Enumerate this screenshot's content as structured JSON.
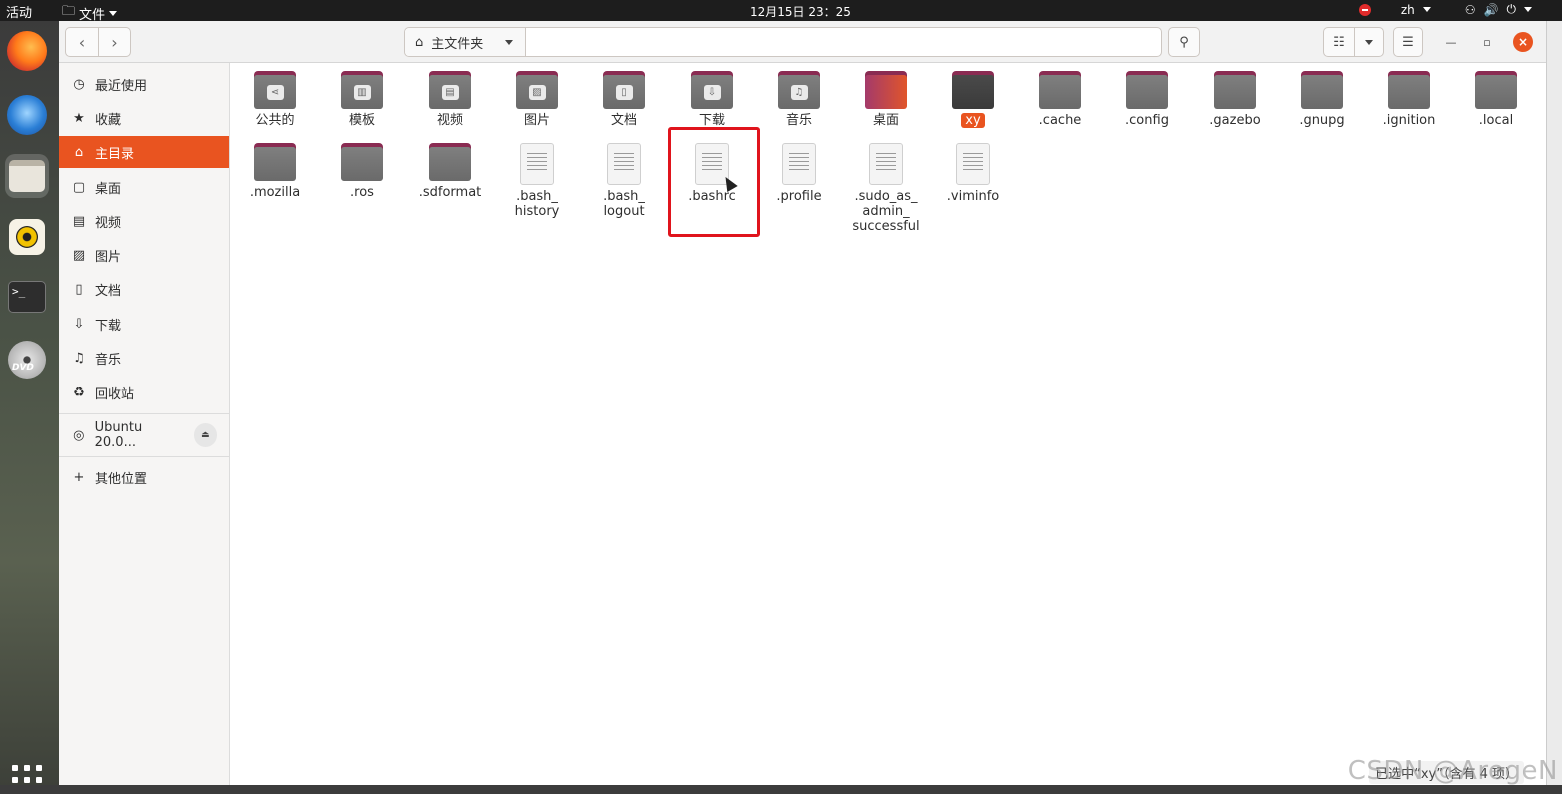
{
  "topbar": {
    "activities": "活动",
    "app_menu": "文件",
    "clock": "12月15日  23：25",
    "input_method": "zh"
  },
  "headerbar": {
    "path_label": "主文件夹"
  },
  "sidebar": {
    "items": [
      {
        "label": "最近使用",
        "icon": "clock-icon"
      },
      {
        "label": "收藏",
        "icon": "star-icon"
      },
      {
        "label": "主目录",
        "icon": "home-icon"
      },
      {
        "label": "桌面",
        "icon": "desktop-icon"
      },
      {
        "label": "视频",
        "icon": "video-icon"
      },
      {
        "label": "图片",
        "icon": "picture-icon"
      },
      {
        "label": "文档",
        "icon": "document-icon"
      },
      {
        "label": "下载",
        "icon": "download-icon"
      },
      {
        "label": "音乐",
        "icon": "music-icon"
      },
      {
        "label": "回收站",
        "icon": "trash-icon"
      }
    ],
    "volume": "Ubuntu 20.0...",
    "other_locations": "其他位置"
  },
  "files": {
    "row1": [
      "公共的",
      "模板",
      "视频",
      "图片",
      "文档",
      "下载",
      "音乐",
      "桌面",
      "xy",
      ".cache",
      ".config",
      ".gazebo",
      ".gnupg",
      ".ignition",
      ".local"
    ],
    "row2": [
      ".mozilla",
      ".ros",
      ".sdformat",
      ".bash_\nhistory",
      ".bash_\nlogout",
      ".bashrc",
      ".profile",
      ".sudo_as_\nadmin_\nsuccessful",
      ".viminfo"
    ]
  },
  "status": "已选中“xy”（含有 4 项）",
  "watermark": "CSDN @AregeN",
  "colors": {
    "accent": "#e95420",
    "highlight_box": "#e0141c"
  }
}
